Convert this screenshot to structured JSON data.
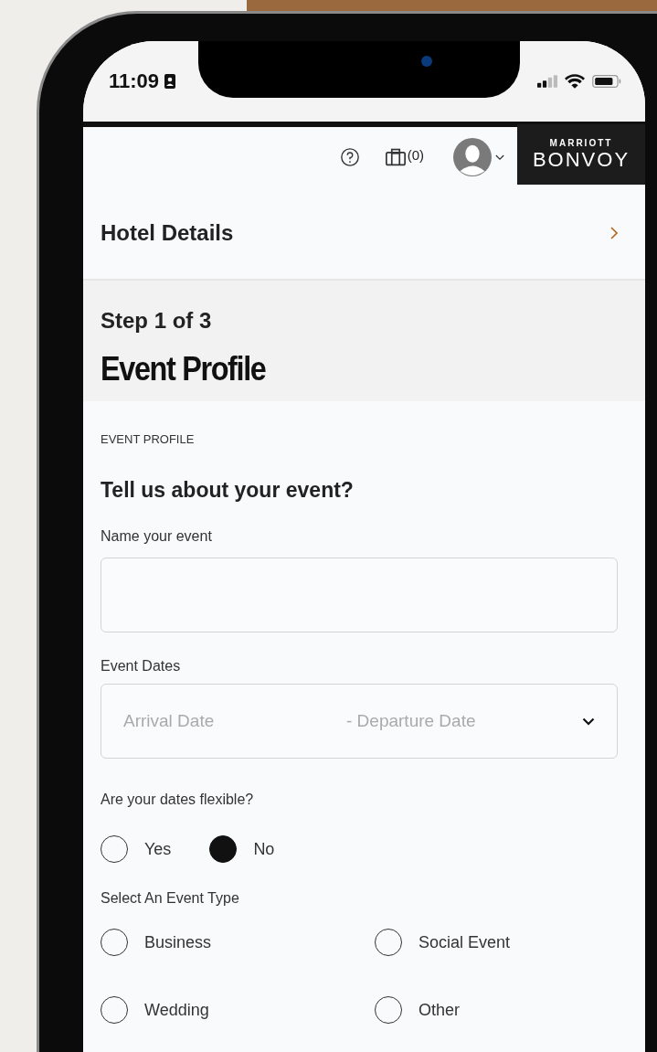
{
  "status_bar": {
    "time": "11:09"
  },
  "header": {
    "bag_count": "(0)",
    "logo": {
      "top": "MARRIOTT",
      "bottom": "BONVOY"
    }
  },
  "nav": {
    "label": "Hotel Details"
  },
  "step": {
    "counter": "Step 1 of 3",
    "title": "Event Profile"
  },
  "form": {
    "section_label": "EVENT PROFILE",
    "heading": "Tell us about your event?",
    "name_field": {
      "label": "Name your event"
    },
    "dates_field": {
      "label": "Event Dates",
      "arrival_placeholder": "Arrival Date",
      "departure_placeholder": "- Departure Date"
    },
    "flexible": {
      "question": "Are your dates flexible?",
      "options": [
        {
          "label": "Yes",
          "selected": false
        },
        {
          "label": "No",
          "selected": true
        }
      ]
    },
    "event_type": {
      "label": "Select An Event Type",
      "options": [
        {
          "label": "Business",
          "selected": false
        },
        {
          "label": "Social Event",
          "selected": false
        },
        {
          "label": "Wedding",
          "selected": false
        },
        {
          "label": "Other",
          "selected": false
        }
      ]
    }
  }
}
